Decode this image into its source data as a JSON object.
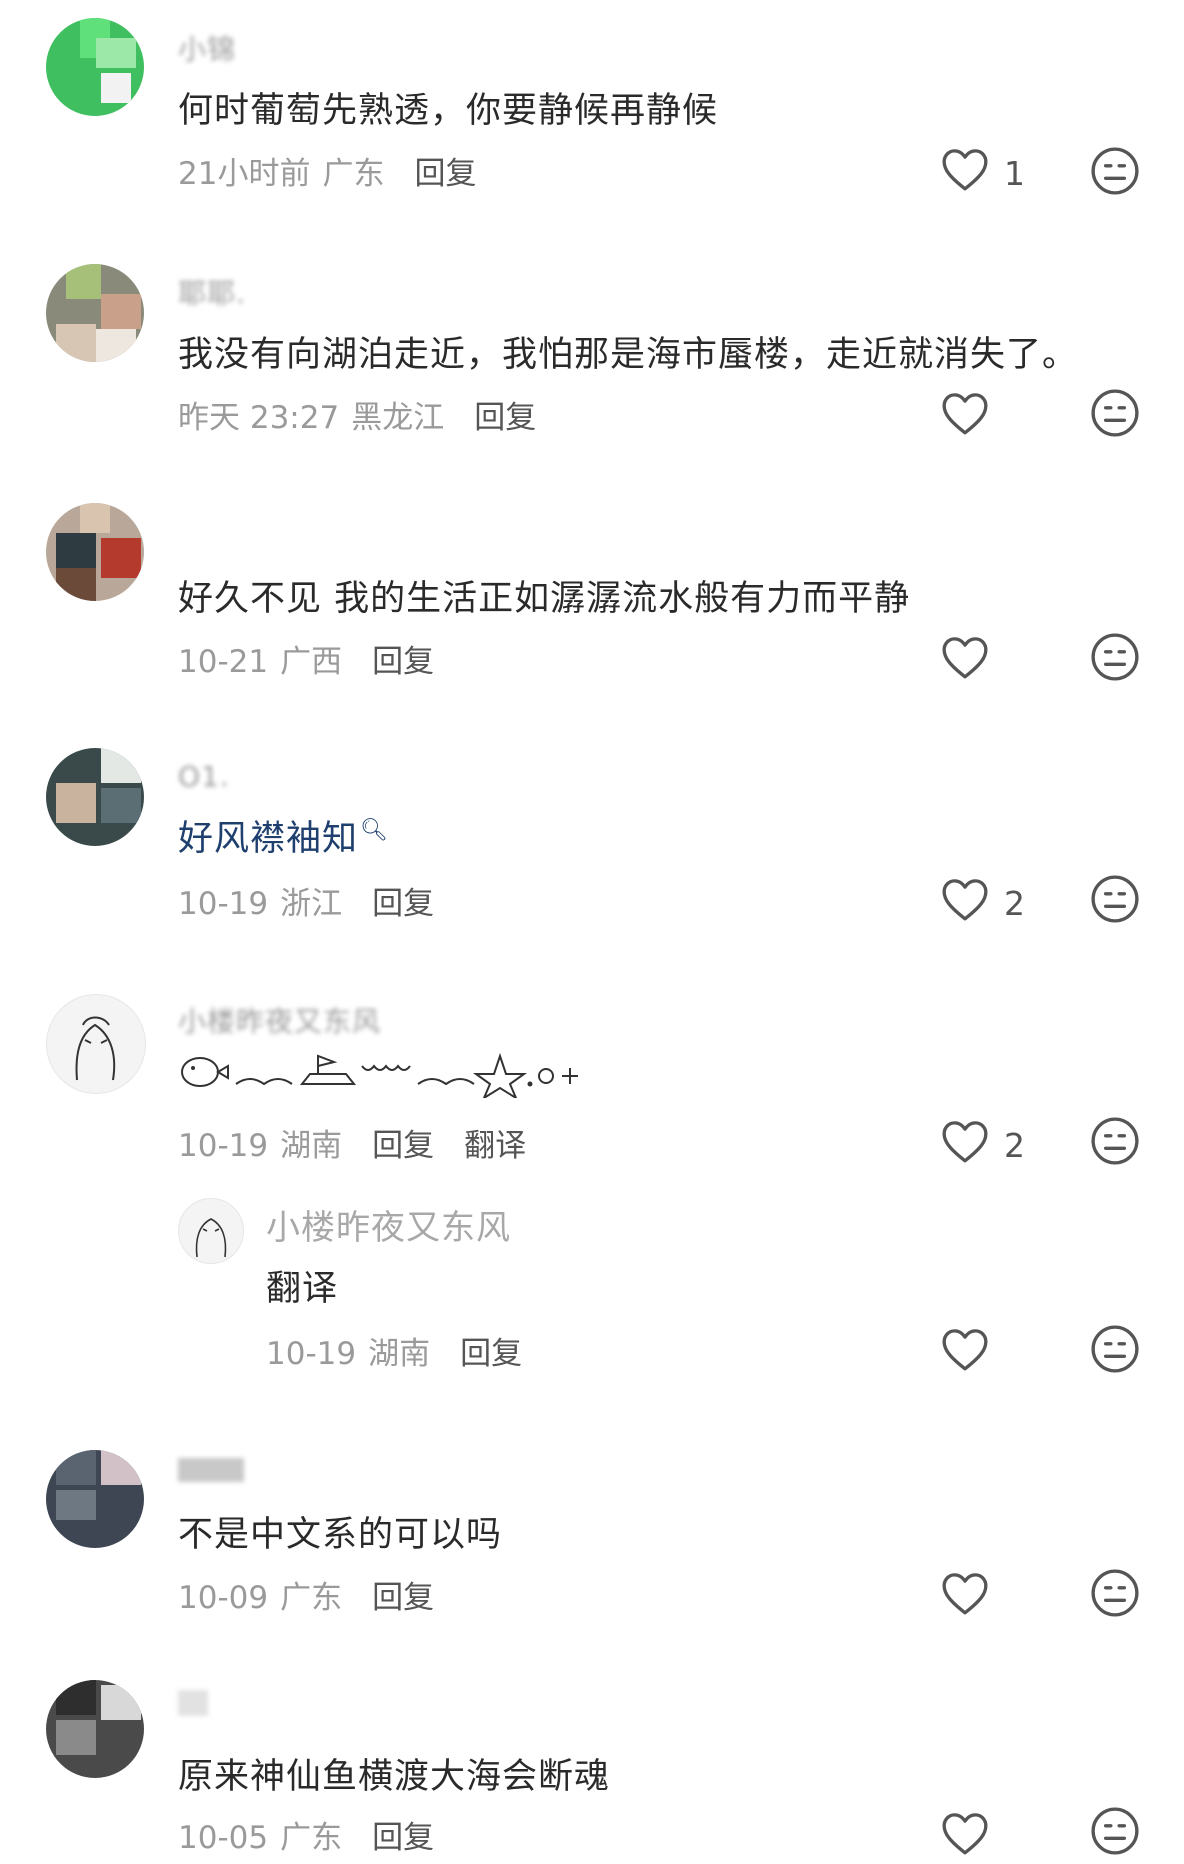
{
  "comments": [
    {
      "username": "小锦",
      "text": "何时葡萄先熟透，你要静候再静候",
      "time": "21小时前",
      "location": "广东",
      "reply_label": "回复",
      "likes": "1"
    },
    {
      "username": "耶耶.",
      "text": "我没有向湖泊走近，我怕那是海市蜃楼，走近就消失了。",
      "time": "昨天 23:27",
      "location": "黑龙江",
      "reply_label": "回复",
      "likes": ""
    },
    {
      "username": "",
      "text": "好久不见 我的生活正如潺潺流水般有力而平静",
      "time": "10-21",
      "location": "广西",
      "reply_label": "回复",
      "likes": ""
    },
    {
      "username": "O1.",
      "text": "好风襟袖知",
      "search_icon": "search-icon",
      "time": "10-19",
      "location": "浙江",
      "reply_label": "回复",
      "likes": "2"
    },
    {
      "username": "小楼昨夜又东风",
      "text": "",
      "decorative": "emoticon-doodle",
      "time": "10-19",
      "location": "湖南",
      "reply_label": "回复",
      "translate_label": "翻译",
      "likes": "2",
      "reply": {
        "username": "小楼昨夜又东风",
        "text": "翻译",
        "time": "10-19",
        "location": "湖南",
        "reply_label": "回复",
        "likes": ""
      }
    },
    {
      "username": "",
      "text": "不是中文系的可以吗",
      "time": "10-09",
      "location": "广东",
      "reply_label": "回复",
      "likes": ""
    },
    {
      "username": "",
      "text": "原来神仙鱼横渡大海会断魂",
      "time": "10-05",
      "location": "广东",
      "reply_label": "回复",
      "likes": ""
    }
  ],
  "icons": {
    "like": "heart-outline-icon",
    "dislike": "neutral-face-icon"
  },
  "colors": {
    "text": "#2a2a2a",
    "meta": "#9a9a9a",
    "action": "#555555",
    "link": "#1f3f6e"
  }
}
